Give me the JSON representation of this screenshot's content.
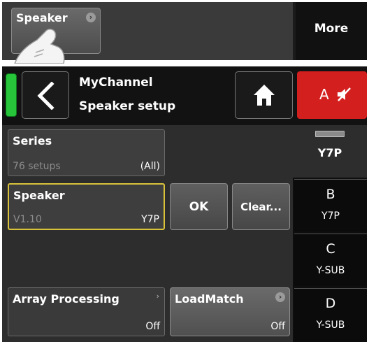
{
  "top_bar": {
    "speaker_button_label": "Speaker",
    "more_button_label": "More"
  },
  "header": {
    "channel_name": "MyChannel",
    "page_title": "Speaker setup",
    "mute_channel_letter": "A"
  },
  "fields": {
    "series": {
      "name": "Series",
      "sub": "76 setups",
      "value": "(All)"
    },
    "speaker": {
      "name": "Speaker",
      "sub": "V1.10",
      "value": "Y7P"
    },
    "ok_label": "OK",
    "clear_label": "Clear...",
    "array_processing": {
      "name": "Array Processing",
      "value": "Off"
    },
    "loadmatch": {
      "name": "LoadMatch",
      "value": "Off"
    }
  },
  "channels": {
    "active": {
      "label": "Y7P"
    },
    "items": [
      {
        "letter": "B",
        "label": "Y7P"
      },
      {
        "letter": "C",
        "label": "Y-SUB"
      },
      {
        "letter": "D",
        "label": "Y-SUB"
      }
    ]
  },
  "colors": {
    "led_green": "#26c53a",
    "mute_red": "#d41f1f",
    "selected_outline": "#d9c23a"
  },
  "icons": {
    "back": "chevron-left-icon",
    "home": "home-icon",
    "mute": "speaker-muted-icon",
    "hand": "hand-pointer-icon",
    "submenu": "chevron-right-icon"
  }
}
